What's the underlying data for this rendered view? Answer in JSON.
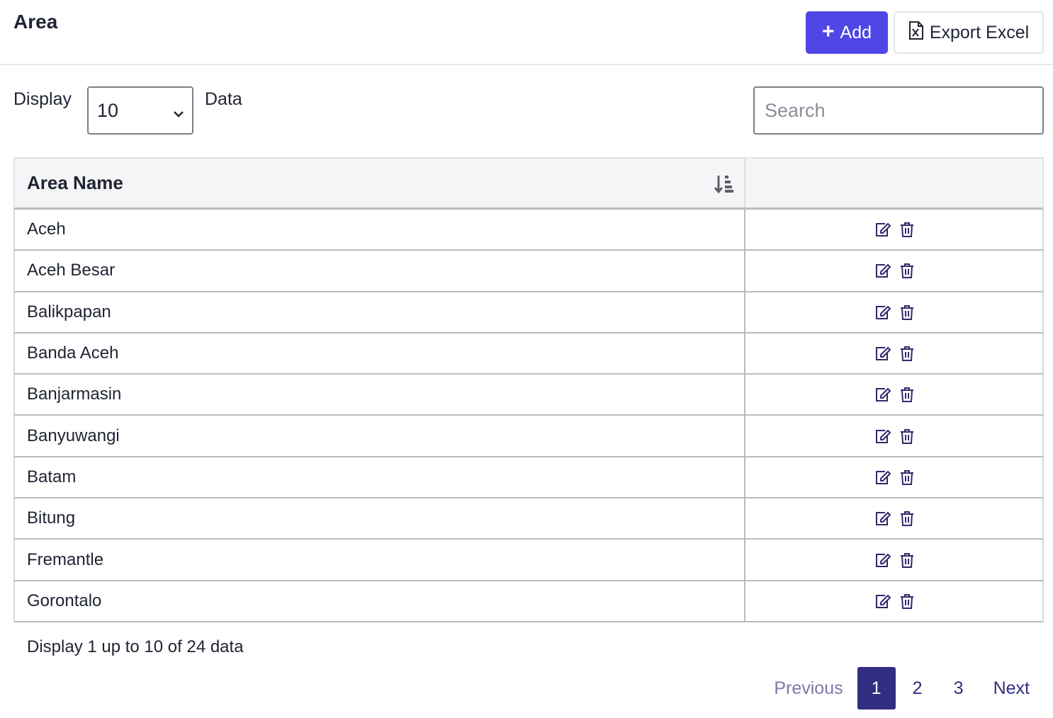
{
  "header": {
    "title": "Area",
    "add_label": "Add",
    "export_label": "Export Excel"
  },
  "controls": {
    "display_label": "Display",
    "page_size": "10",
    "data_label": "Data",
    "search_placeholder": "Search"
  },
  "table": {
    "columns": [
      "Area Name",
      ""
    ],
    "rows": [
      "Aceh",
      "Aceh Besar",
      "Balikpapan",
      "Banda Aceh",
      "Banjarmasin",
      "Banyuwangi",
      "Batam",
      "Bitung",
      "Fremantle",
      "Gorontalo"
    ]
  },
  "footer": {
    "summary": "Display 1 up to 10 of 24 data",
    "pagination": {
      "previous": "Previous",
      "pages": [
        "1",
        "2",
        "3"
      ],
      "active": "1",
      "next": "Next"
    }
  },
  "colors": {
    "primary": "#4f46e5",
    "pagination_active": "#312e81",
    "icon": "#2e2a6b"
  },
  "icons": {
    "add": "plus-icon",
    "export": "excel-file-icon",
    "sort": "sort-alpha-down-icon",
    "edit": "edit-icon",
    "delete": "trash-icon",
    "dropdown": "chevron-down-icon"
  }
}
